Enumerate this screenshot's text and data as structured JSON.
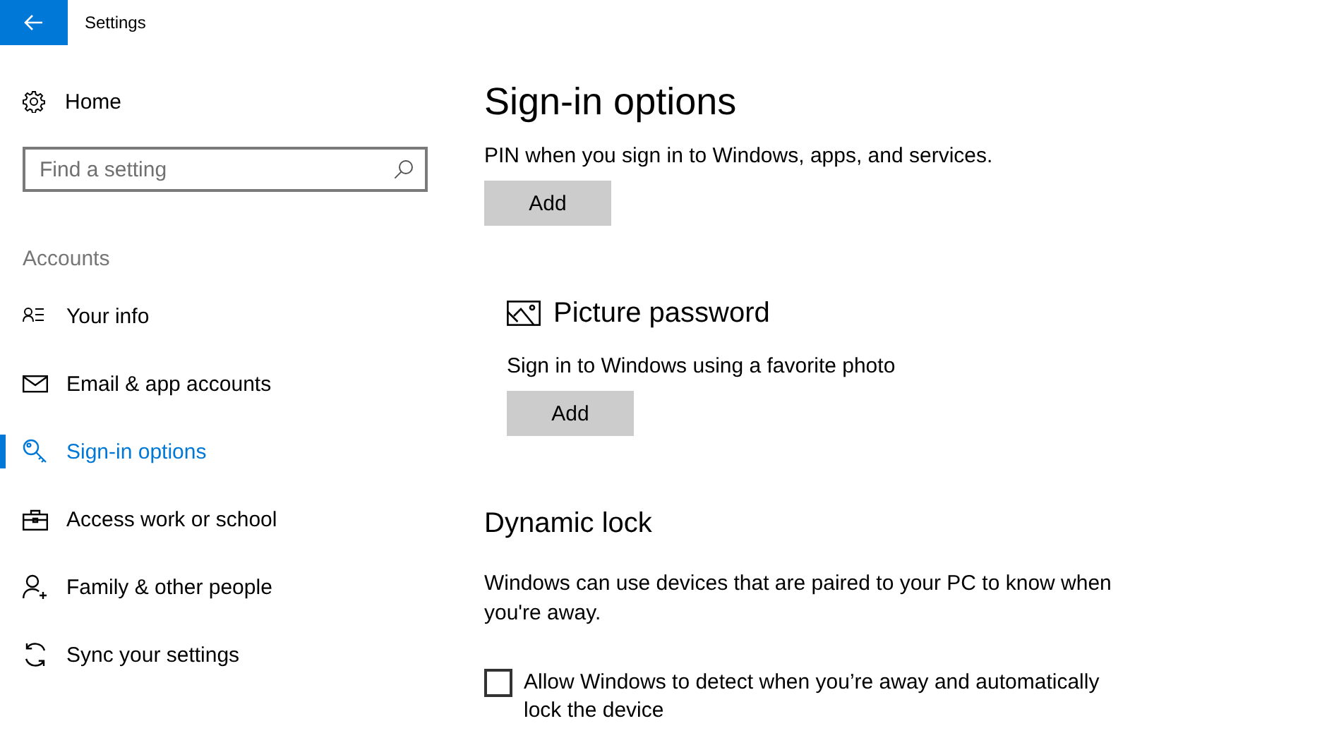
{
  "window": {
    "title": "Settings"
  },
  "sidebar": {
    "home": "Home",
    "search": {
      "placeholder": "Find a setting"
    },
    "section": "Accounts",
    "items": [
      {
        "label": "Your info",
        "selected": false
      },
      {
        "label": "Email & app accounts",
        "selected": false
      },
      {
        "label": "Sign-in options",
        "selected": true
      },
      {
        "label": "Access work or school",
        "selected": false
      },
      {
        "label": "Family & other people",
        "selected": false
      },
      {
        "label": "Sync your settings",
        "selected": false
      }
    ]
  },
  "main": {
    "title": "Sign-in options",
    "pin": {
      "description": "PIN when you sign in to Windows, apps, and services.",
      "button": "Add"
    },
    "picture_password": {
      "heading": "Picture password",
      "description": "Sign in to Windows using a favorite photo",
      "button": "Add"
    },
    "dynamic_lock": {
      "heading": "Dynamic lock",
      "description": "Windows can use devices that are paired to your PC to know when you're away.",
      "checkbox": {
        "label": "Allow Windows to detect when you’re away and automatically lock the device",
        "checked": false
      }
    }
  }
}
